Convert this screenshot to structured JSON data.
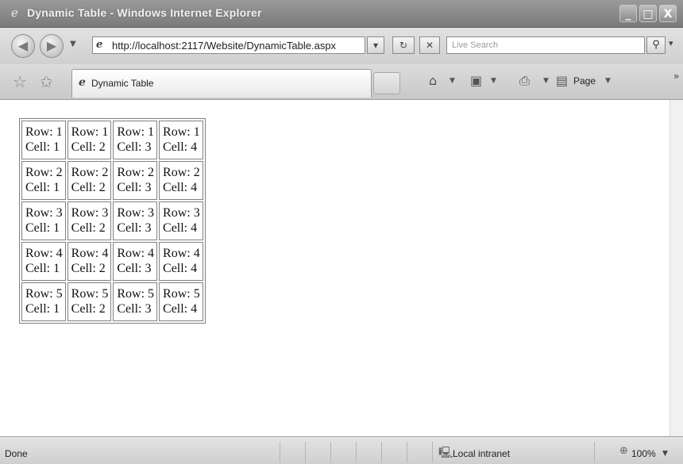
{
  "window": {
    "title": "Dynamic Table - Windows Internet Explorer",
    "icon": "ie-logo-icon",
    "controls": {
      "minimize": "_",
      "maximize": "□",
      "close": "X"
    }
  },
  "addressbar": {
    "back_icon": "back-arrow-icon",
    "forward_icon": "forward-arrow-icon",
    "url": "http://localhost:2117/Website/DynamicTable.aspx",
    "search_placeholder": "Live Search"
  },
  "tabs": [
    {
      "label": "Dynamic Table",
      "active": true
    }
  ],
  "commandbar": {
    "page_label": "Page"
  },
  "table": {
    "rows": [
      [
        [
          "Row: 1",
          "Cell: 1"
        ],
        [
          "Row: 1",
          "Cell: 2"
        ],
        [
          "Row: 1",
          "Cell: 3"
        ],
        [
          "Row: 1",
          "Cell: 4"
        ]
      ],
      [
        [
          "Row: 2",
          "Cell: 1"
        ],
        [
          "Row: 2",
          "Cell: 2"
        ],
        [
          "Row: 2",
          "Cell: 3"
        ],
        [
          "Row: 2",
          "Cell: 4"
        ]
      ],
      [
        [
          "Row: 3",
          "Cell: 1"
        ],
        [
          "Row: 3",
          "Cell: 2"
        ],
        [
          "Row: 3",
          "Cell: 3"
        ],
        [
          "Row: 3",
          "Cell: 4"
        ]
      ],
      [
        [
          "Row: 4",
          "Cell: 1"
        ],
        [
          "Row: 4",
          "Cell: 2"
        ],
        [
          "Row: 4",
          "Cell: 3"
        ],
        [
          "Row: 4",
          "Cell: 4"
        ]
      ],
      [
        [
          "Row: 5",
          "Cell: 1"
        ],
        [
          "Row: 5",
          "Cell: 2"
        ],
        [
          "Row: 5",
          "Cell: 3"
        ],
        [
          "Row: 5",
          "Cell: 4"
        ]
      ]
    ]
  },
  "statusbar": {
    "status": "Done",
    "zone": "Local intranet",
    "zoom": "100%"
  }
}
